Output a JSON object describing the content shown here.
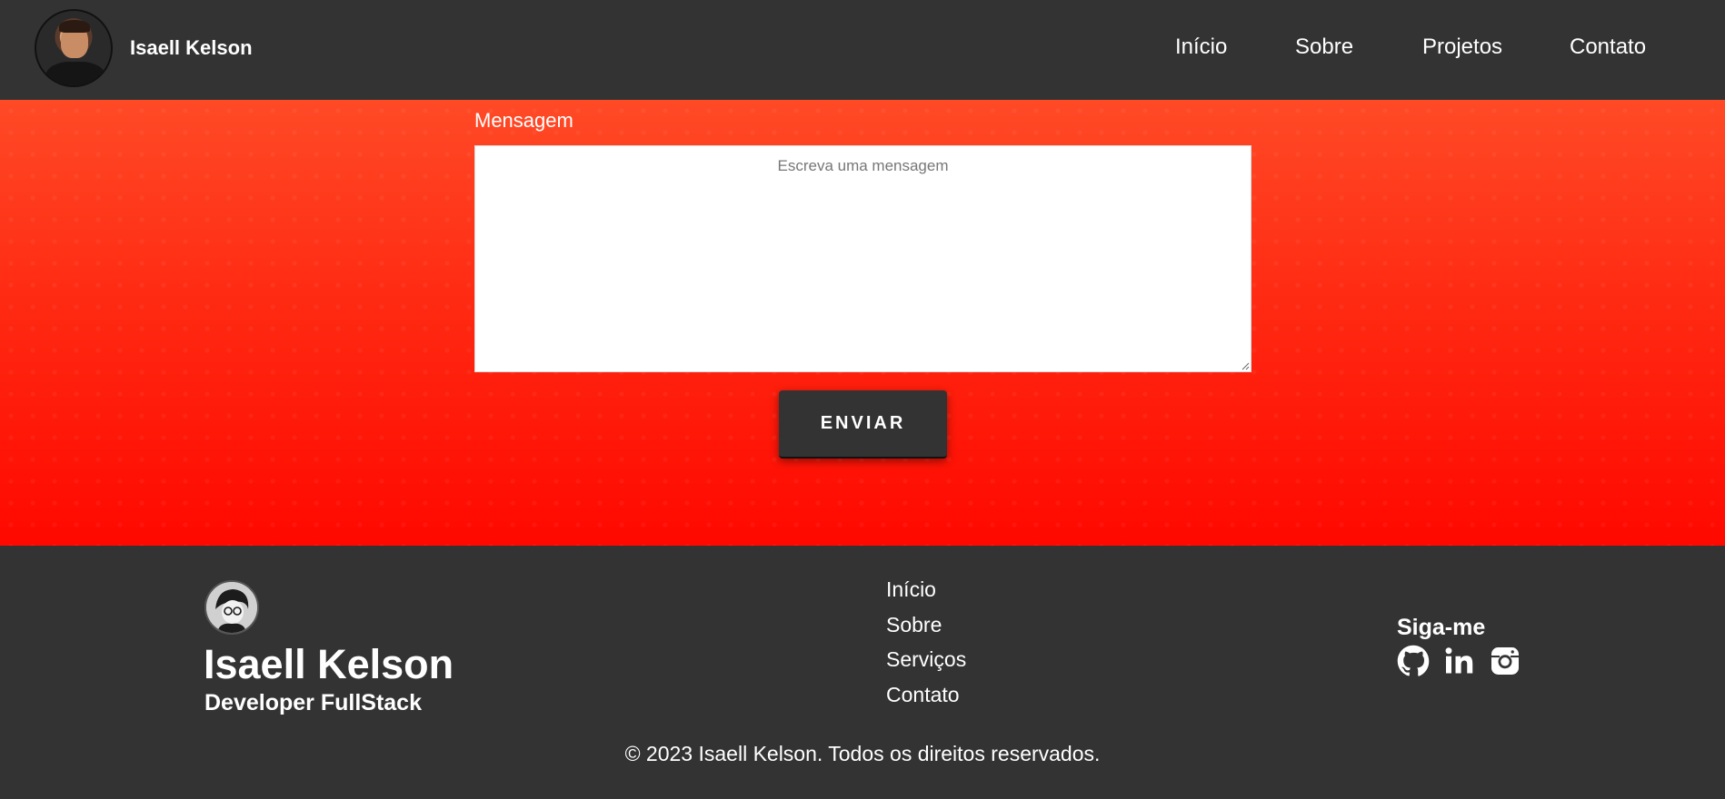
{
  "header": {
    "brand_name": "Isaell Kelson",
    "nav": [
      {
        "label": "Início"
      },
      {
        "label": "Sobre"
      },
      {
        "label": "Projetos"
      },
      {
        "label": "Contato"
      }
    ]
  },
  "contact_form": {
    "message_label": "Mensagem",
    "message_placeholder": "Escreva uma mensagem",
    "message_value": "",
    "submit_label": "ENVIAR"
  },
  "footer": {
    "name": "Isaell Kelson",
    "role": "Developer FullStack",
    "links": [
      {
        "label": "Início"
      },
      {
        "label": "Sobre"
      },
      {
        "label": "Serviços"
      },
      {
        "label": "Contato"
      }
    ],
    "follow_label": "Siga-me",
    "social": [
      {
        "icon": "github-icon"
      },
      {
        "icon": "linkedin-icon"
      },
      {
        "icon": "instagram-icon"
      }
    ],
    "copyright": "© 2023 Isaell Kelson. Todos os direitos reservados."
  },
  "colors": {
    "header_bg": "#333333",
    "hero_top": "#ff4a26",
    "hero_bottom": "#ff0800",
    "button_bg": "#333333",
    "text": "#ffffff"
  }
}
